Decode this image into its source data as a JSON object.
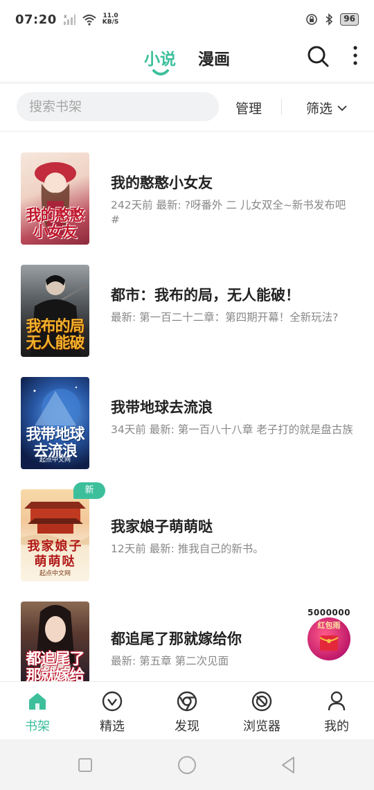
{
  "status_bar": {
    "time": "07:20",
    "net_speed_value": "11.0",
    "net_speed_unit": "KB/S",
    "battery": "96"
  },
  "top_tabs": {
    "novel": "小说",
    "comic": "漫画"
  },
  "search": {
    "placeholder": "搜索书架",
    "manage": "管理",
    "filter": "筛选"
  },
  "books": [
    {
      "title": "我的憨憨小女友",
      "desc": "242天前 最新: ?呀番外 二 儿女双全~新书发布吧#",
      "cover_text": "我的憨憨小女友",
      "new": false
    },
    {
      "title": "都市：我布的局，无人能破！",
      "desc": "最新: 第一百二十二章：第四期开幕！全新玩法?",
      "cover_text": "我布的局无人能破",
      "new": false
    },
    {
      "title": "我带地球去流浪",
      "desc": "34天前 最新: 第一百八十八章 老子打的就是盘古族",
      "cover_text": "我带地球去流浪",
      "cover_publisher": "起点中文网",
      "new": false
    },
    {
      "title": "我家娘子萌萌哒",
      "desc": "12天前 最新: 推我自己的新书。",
      "cover_text": "我家娘子萌萌哒",
      "cover_publisher": "起点中文网",
      "new": true,
      "badge": "新"
    },
    {
      "title": "都追尾了那就嫁给你",
      "desc": "最新: 第五章 第二次见面",
      "cover_text": "都追尾了那就嫁给你",
      "new": false
    }
  ],
  "red_packet": {
    "amount": "5000000",
    "label": "红包雨"
  },
  "bottom_nav": [
    {
      "label": "书架",
      "icon": "home-icon",
      "active": true
    },
    {
      "label": "精选",
      "icon": "diamond-icon",
      "active": false
    },
    {
      "label": "发现",
      "icon": "compass-icon",
      "active": false
    },
    {
      "label": "浏览器",
      "icon": "browser-icon",
      "active": false
    },
    {
      "label": "我的",
      "icon": "user-icon",
      "active": false
    }
  ],
  "colors": {
    "accent": "#3dbf9c",
    "text": "#222222",
    "muted": "#888888"
  }
}
